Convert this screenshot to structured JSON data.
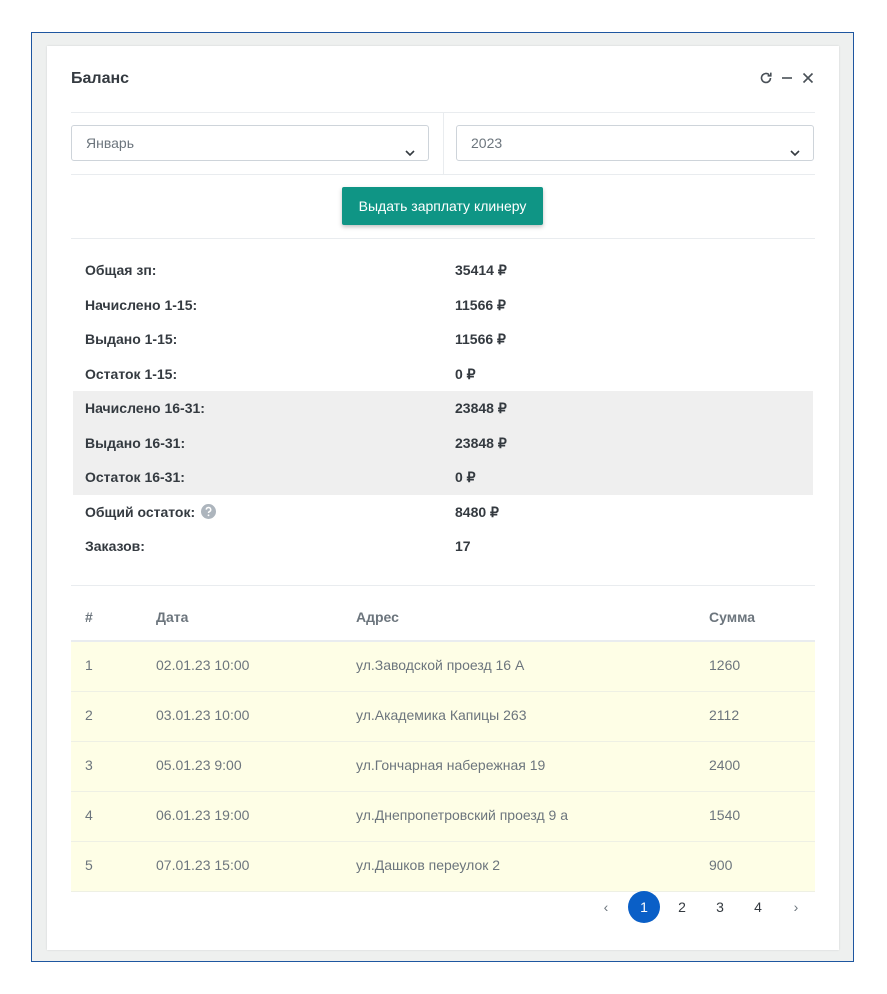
{
  "card": {
    "title": "Баланс"
  },
  "filters": {
    "month": "Январь",
    "year": "2023"
  },
  "actions": {
    "pay_label": "Выдать зарплату клинеру"
  },
  "stats": [
    {
      "label": "Общая зп:",
      "value": "35414 ₽",
      "shaded": false
    },
    {
      "label": "Начислено 1-15:",
      "value": "11566 ₽",
      "shaded": false
    },
    {
      "label": "Выдано 1-15:",
      "value": "11566 ₽",
      "shaded": false
    },
    {
      "label": "Остаток 1-15:",
      "value": "0 ₽",
      "shaded": false
    },
    {
      "label": "Начислено 16-31:",
      "value": "23848 ₽",
      "shaded": true
    },
    {
      "label": "Выдано 16-31:",
      "value": "23848 ₽",
      "shaded": true
    },
    {
      "label": "Остаток 16-31:",
      "value": "0 ₽",
      "shaded": true
    },
    {
      "label": "Общий остаток:",
      "value": "8480 ₽",
      "shaded": false,
      "help": true
    },
    {
      "label": "Заказов:",
      "value": "17",
      "shaded": false
    }
  ],
  "table": {
    "headers": [
      "#",
      "Дата",
      "Адрес",
      "Сумма"
    ],
    "rows": [
      [
        "1",
        "02.01.23 10:00",
        "ул.Заводской проезд 16 А",
        "1260"
      ],
      [
        "2",
        "03.01.23 10:00",
        "ул.Академика Капицы 263",
        "2112"
      ],
      [
        "3",
        "05.01.23 9:00",
        "ул.Гончарная набережная 19",
        "2400"
      ],
      [
        "4",
        "06.01.23 19:00",
        "ул.Днепропетровский проезд 9 а",
        "1540"
      ],
      [
        "5",
        "07.01.23 15:00",
        "ул.Дашков переулок 2",
        "900"
      ]
    ]
  },
  "pagination": {
    "pages": [
      "1",
      "2",
      "3",
      "4"
    ],
    "active": "1",
    "prev": "‹",
    "next": "›"
  },
  "colors": {
    "accent": "#0f9585",
    "page_active": "#0a5fc7",
    "row_bg": "#fefee6",
    "frame": "#1e56a0"
  }
}
